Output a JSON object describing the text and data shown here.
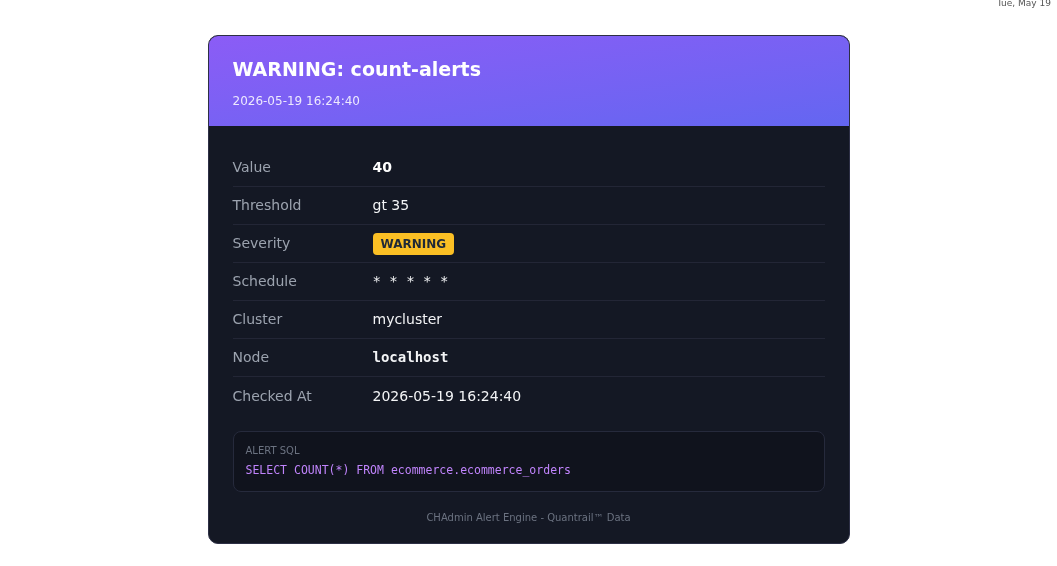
{
  "top_bar": {
    "date": "Tue, May 19"
  },
  "header": {
    "title": "WARNING: count-alerts",
    "timestamp": "2026-05-19 16:24:40"
  },
  "details": [
    {
      "label": "Value",
      "value": "40",
      "kind": "bold"
    },
    {
      "label": "Threshold",
      "value": "gt 35",
      "kind": "text"
    },
    {
      "label": "Severity",
      "value": "WARNING",
      "kind": "badge",
      "color": "#fbbf24"
    },
    {
      "label": "Schedule",
      "value": "* * * * *",
      "kind": "mono"
    },
    {
      "label": "Cluster",
      "value": "mycluster",
      "kind": "text"
    },
    {
      "label": "Node",
      "value": "localhost",
      "kind": "mono-bold"
    },
    {
      "label": "Checked At",
      "value": "2026-05-19 16:24:40",
      "kind": "text"
    }
  ],
  "sql": {
    "label": "ALERT SQL",
    "query": "SELECT COUNT(*) FROM ecommerce.ecommerce_orders"
  },
  "footer": "CHAdmin Alert Engine - Quantrail™ Data"
}
